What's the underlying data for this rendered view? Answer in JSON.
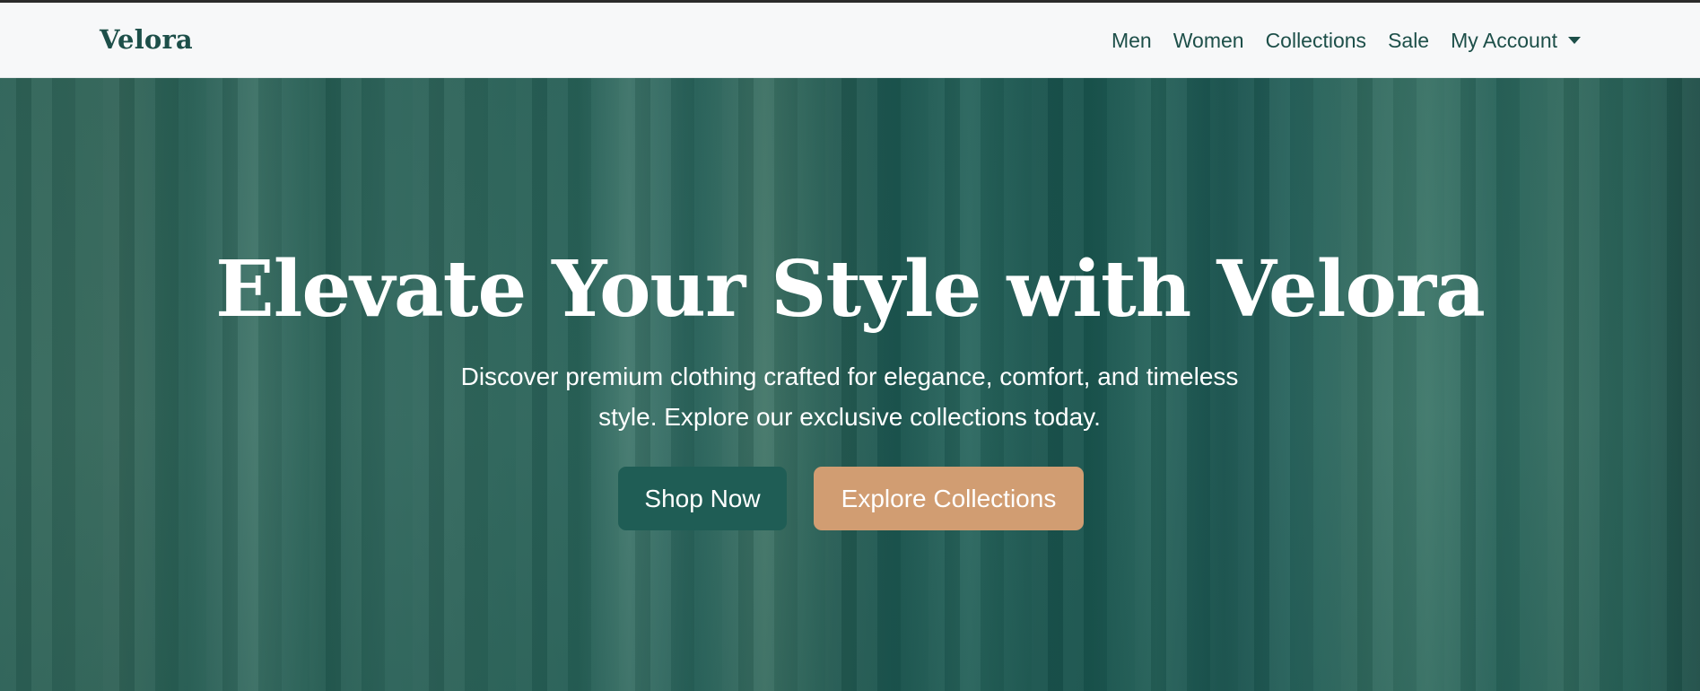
{
  "brand": {
    "name": "Velora"
  },
  "nav": {
    "items": [
      {
        "label": "Men"
      },
      {
        "label": "Women"
      },
      {
        "label": "Collections"
      },
      {
        "label": "Sale"
      },
      {
        "label": "My Account",
        "dropdown": true
      }
    ]
  },
  "hero": {
    "title": "Elevate Your Style with Velora",
    "subtitle": "Discover premium clothing crafted for elegance, comfort, and timeless style. Explore our exclusive collections today.",
    "primary_button": "Shop Now",
    "secondary_button": "Explore Collections"
  },
  "icons": {
    "account_dropdown": "chevron-down-icon"
  },
  "colors": {
    "brand": "#1d4f49",
    "nav_background": "#f7f8f9",
    "hero_overlay": "#1d5a53",
    "primary_button": "#1f5d55",
    "secondary_button": "#d19d72",
    "text_light": "#ffffff"
  }
}
